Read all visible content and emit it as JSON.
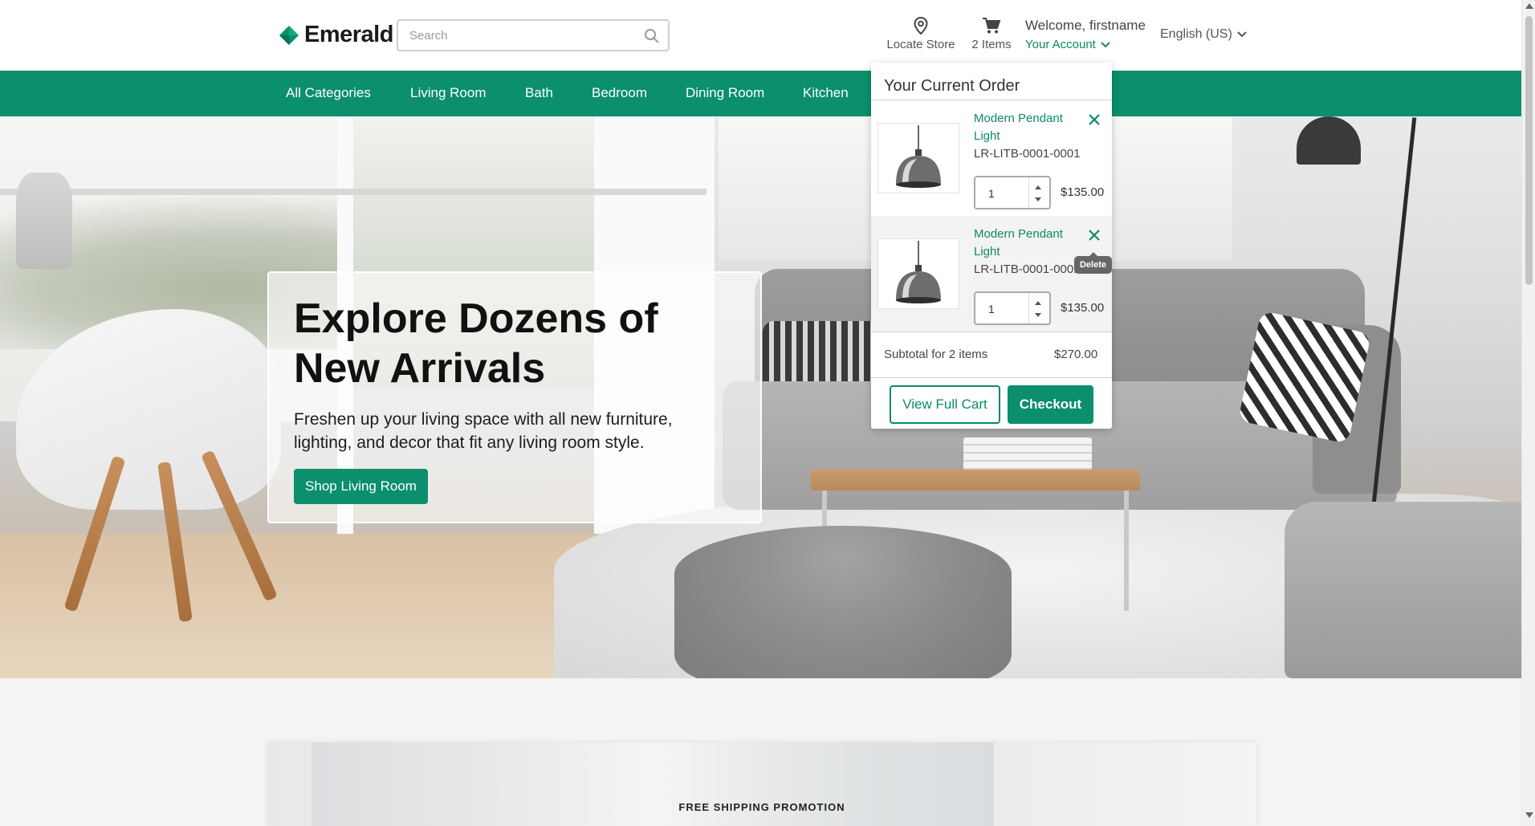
{
  "header": {
    "logo_text": "Emerald",
    "search_placeholder": "Search",
    "locate_store_label": "Locate Store",
    "cart_label": "2 Items",
    "welcome_text": "Welcome, firstname",
    "account_label": "Your Account",
    "language_label": "English (US)"
  },
  "nav": {
    "items": [
      {
        "label": "All Categories"
      },
      {
        "label": "Living Room"
      },
      {
        "label": "Bath"
      },
      {
        "label": "Bedroom"
      },
      {
        "label": "Dining Room"
      },
      {
        "label": "Kitchen"
      }
    ]
  },
  "hero": {
    "title": "Explore Dozens of New Arrivals",
    "subtitle": "Freshen up your living space with all new furniture, lighting, and decor that fit any living room style.",
    "cta_label": "Shop Living Room"
  },
  "promo": {
    "label": "FREE SHIPPING PROMOTION"
  },
  "cart_dropdown": {
    "title": "Your Current Order",
    "items": [
      {
        "name": "Modern Pendant Light",
        "sku": "LR-LITB-0001-0001",
        "quantity": "1",
        "price": "$135.00"
      },
      {
        "name": "Modern Pendant Light",
        "sku": "LR-LITB-0001-0001",
        "quantity": "1",
        "price": "$135.00"
      }
    ],
    "delete_tooltip": "Delete",
    "subtotal_label": "Subtotal for 2 items",
    "subtotal_value": "$270.00",
    "view_cart_label": "View Full Cart",
    "checkout_label": "Checkout"
  },
  "colors": {
    "brand": "#0b8f6c",
    "link": "#0d8a6a"
  }
}
